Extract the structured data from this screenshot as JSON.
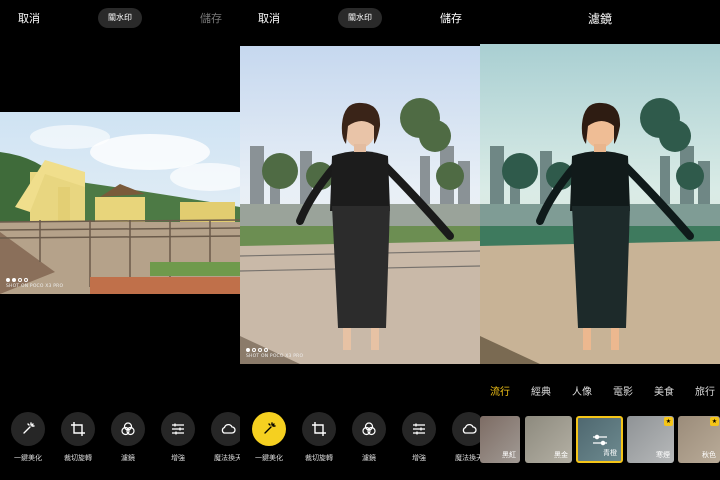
{
  "screen1": {
    "cancel": "取消",
    "watermark_toggle": "關水印",
    "save": "儲存",
    "watermark": "SHOT ON POCO X3 PRO",
    "tools": [
      {
        "label": "一鍵美化",
        "icon": "magic-wand-icon"
      },
      {
        "label": "裁切旋轉",
        "icon": "crop-icon"
      },
      {
        "label": "濾鏡",
        "icon": "filter-circles-icon"
      },
      {
        "label": "增強",
        "icon": "sliders-icon"
      },
      {
        "label": "魔法換天",
        "icon": "cloud-icon"
      }
    ]
  },
  "screen2": {
    "cancel": "取消",
    "watermark_toggle": "關水印",
    "save": "儲存",
    "watermark": "SHOT ON POCO X3 PRO",
    "tools": [
      {
        "label": "一鍵美化",
        "icon": "magic-wand-icon",
        "active": true
      },
      {
        "label": "裁切旋轉",
        "icon": "crop-icon"
      },
      {
        "label": "濾鏡",
        "icon": "filter-circles-icon"
      },
      {
        "label": "增強",
        "icon": "sliders-icon"
      },
      {
        "label": "魔法換天",
        "icon": "cloud-icon"
      }
    ]
  },
  "screen3": {
    "title": "濾鏡",
    "categories": [
      {
        "label": "流行",
        "selected": true
      },
      {
        "label": "經典"
      },
      {
        "label": "人像"
      },
      {
        "label": "電影"
      },
      {
        "label": "美食"
      },
      {
        "label": "旅行"
      }
    ],
    "filters": [
      {
        "label": "黑紅"
      },
      {
        "label": "黑金"
      },
      {
        "label": "青橙",
        "selected": true
      },
      {
        "label": "寒煙",
        "badge": true
      },
      {
        "label": "秋色",
        "badge": true
      }
    ]
  },
  "colors": {
    "accent": "#f5c518",
    "active_tool": "#f5d020",
    "tool_bg": "#262626",
    "pill_bg": "#2a2a2a"
  }
}
